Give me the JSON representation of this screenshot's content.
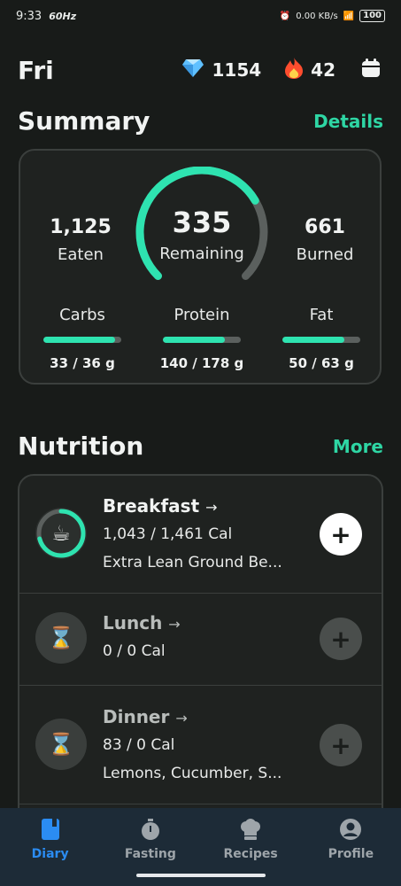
{
  "status_bar": {
    "time": "9:33",
    "refresh": "60Hz",
    "net_speed": "0.00 KB/s",
    "battery": "100"
  },
  "header": {
    "day": "Fri",
    "gems": "1154",
    "streak": "42"
  },
  "summary": {
    "title": "Summary",
    "details_label": "Details",
    "eaten_value": "1,125",
    "eaten_label": "Eaten",
    "remaining_value": "335",
    "remaining_label": "Remaining",
    "burned_value": "661",
    "burned_label": "Burned",
    "remaining_progress": 0.72,
    "macros": [
      {
        "name": "Carbs",
        "value": "33 / 36 g",
        "progress": 0.92
      },
      {
        "name": "Protein",
        "value": "140 / 178 g",
        "progress": 0.79
      },
      {
        "name": "Fat",
        "value": "50 / 63 g",
        "progress": 0.79
      }
    ]
  },
  "nutrition": {
    "title": "Nutrition",
    "more_label": "More",
    "meals": [
      {
        "name": "Breakfast",
        "calories": "1,043 / 1,461 Cal",
        "foods": "Extra Lean Ground Be...",
        "progress": 0.71
      },
      {
        "name": "Lunch",
        "calories": "0 / 0 Cal",
        "foods": ""
      },
      {
        "name": "Dinner",
        "calories": "83 / 0 Cal",
        "foods": "Lemons, Cucumber, S..."
      }
    ]
  },
  "bottom_nav": {
    "items": [
      "Diary",
      "Fasting",
      "Recipes",
      "Profile"
    ],
    "active": "Diary"
  },
  "colors": {
    "accent": "#2ed6a4",
    "nav_active": "#2b8cf2"
  }
}
